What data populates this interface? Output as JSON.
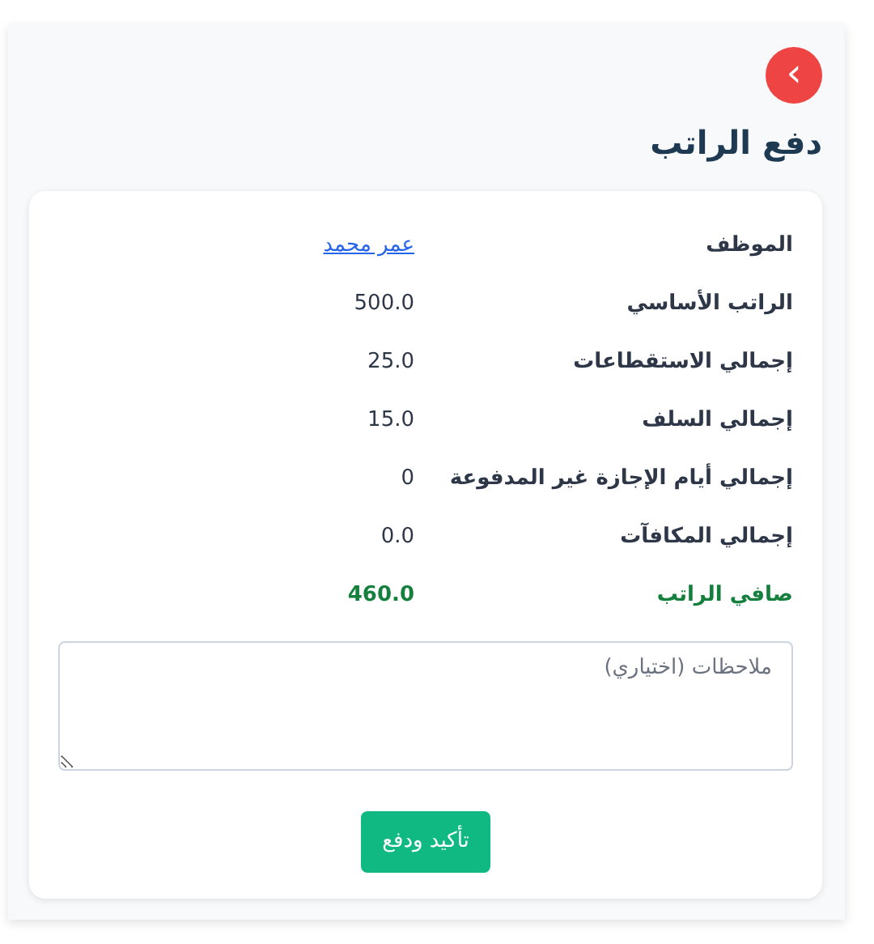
{
  "back_button": {
    "icon": "›"
  },
  "title": "دفع الراتب",
  "rows": [
    {
      "label": "الموظف",
      "value": "عمر محمد",
      "kind": "link"
    },
    {
      "label": "الراتب الأساسي",
      "value": "500.0",
      "kind": "text"
    },
    {
      "label": "إجمالي الاستقطاعات",
      "value": "25.0",
      "kind": "text"
    },
    {
      "label": "إجمالي السلف",
      "value": "15.0",
      "kind": "text"
    },
    {
      "label": "إجمالي أيام الإجازة غير المدفوعة",
      "value": "0",
      "kind": "text"
    },
    {
      "label": "إجمالي المكافآت",
      "value": "0.0",
      "kind": "text"
    },
    {
      "label": "صافي الراتب",
      "value": "460.0",
      "kind": "total"
    }
  ],
  "notes": {
    "placeholder": "ملاحظات (اختياري)"
  },
  "submit_button": "تأكيد ودفع"
}
